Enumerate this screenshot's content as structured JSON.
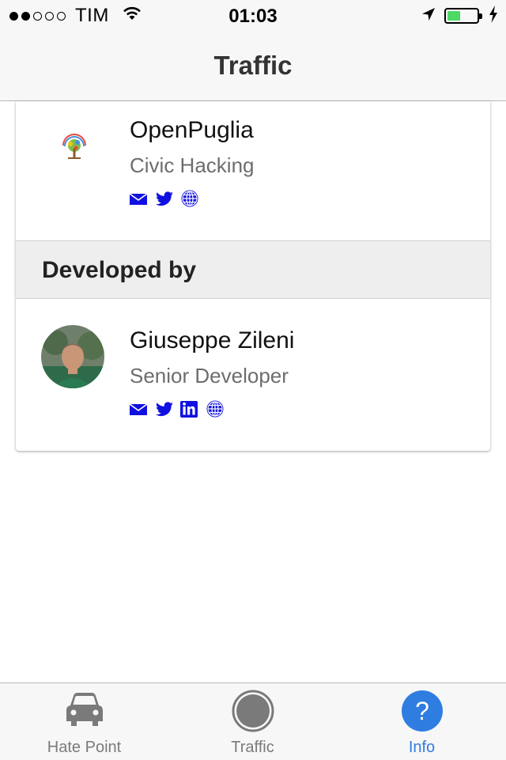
{
  "status_bar": {
    "carrier": "TIM",
    "time": "01:03",
    "signal_strength": 2,
    "signal_max": 5,
    "battery_level": 0.45,
    "battery_color": "#4cd964",
    "icons": [
      "wifi-icon",
      "location-arrow-icon",
      "battery-icon",
      "charging-bolt-icon"
    ]
  },
  "nav": {
    "title": "Traffic"
  },
  "card": {
    "organization": {
      "name": "OpenPuglia",
      "role": "Civic Hacking",
      "logo": "tree-logo-icon",
      "links": [
        "email-icon",
        "twitter-icon",
        "website-globe-icon"
      ]
    },
    "section_header": "Developed by",
    "developer": {
      "name": "Giuseppe Zileni",
      "role": "Senior Developer",
      "avatar": "avatar-photo",
      "links": [
        "email-icon",
        "twitter-icon",
        "linkedin-icon",
        "website-globe-icon"
      ]
    }
  },
  "tab_bar": {
    "tabs": [
      {
        "label": "Hate Point",
        "icon": "car-icon",
        "active": false
      },
      {
        "label": "Traffic",
        "icon": "record-circle-icon",
        "active": false
      },
      {
        "label": "Info",
        "icon": "question-circle-icon",
        "active": true
      }
    ],
    "active_color": "#2f7de1",
    "inactive_color": "#7a7a7a"
  },
  "link_color": "#1010e0"
}
